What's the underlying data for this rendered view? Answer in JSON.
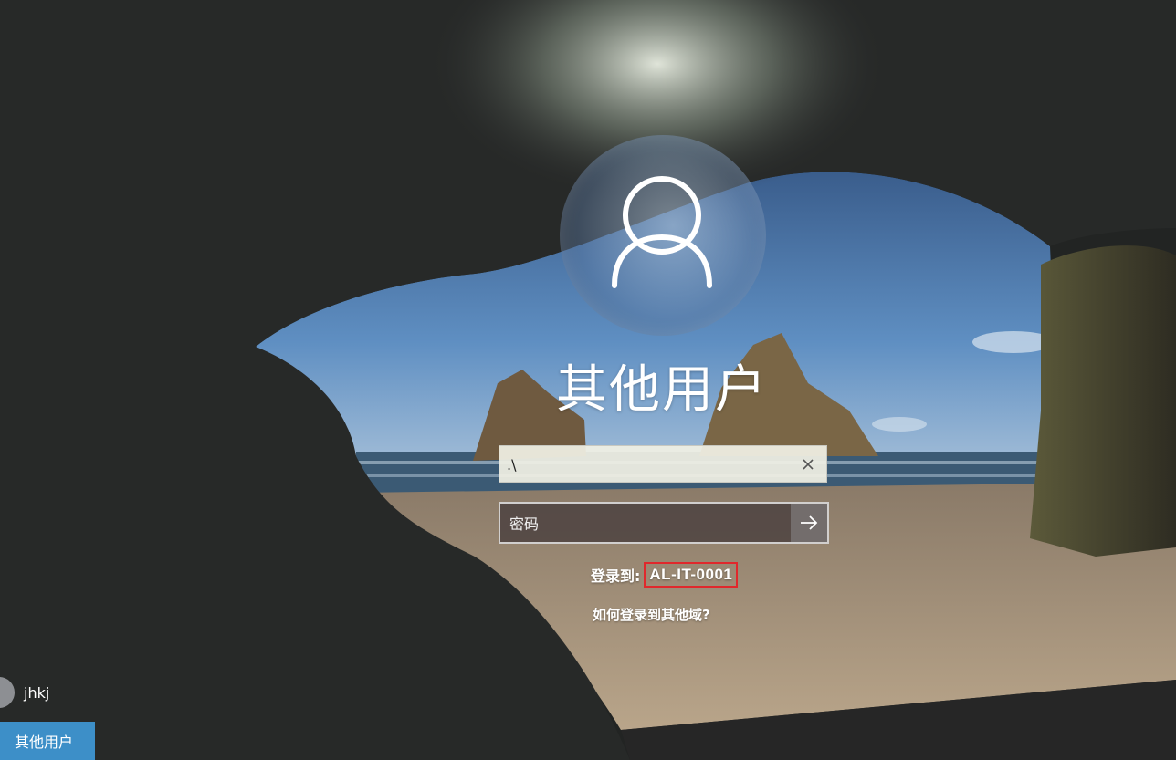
{
  "login": {
    "user_display_name": "其他用户",
    "username_field": {
      "value": ".\\"
    },
    "password_field": {
      "placeholder": "密码"
    },
    "signin_to_label": "登录到:",
    "domain_name": "AL-IT-0001",
    "other_domain_link": "如何登录到其他域?"
  },
  "user_list": {
    "items": [
      {
        "label": "jhkj",
        "selected": false
      },
      {
        "label": "其他用户",
        "selected": true
      }
    ]
  },
  "icons": {
    "avatar": "user-silhouette-icon",
    "clear": "close-icon",
    "submit": "arrow-right-icon"
  },
  "colors": {
    "highlight_box": "#e0282c",
    "selected_user_tile": "#3d8fc8",
    "text": "#ffffff"
  }
}
